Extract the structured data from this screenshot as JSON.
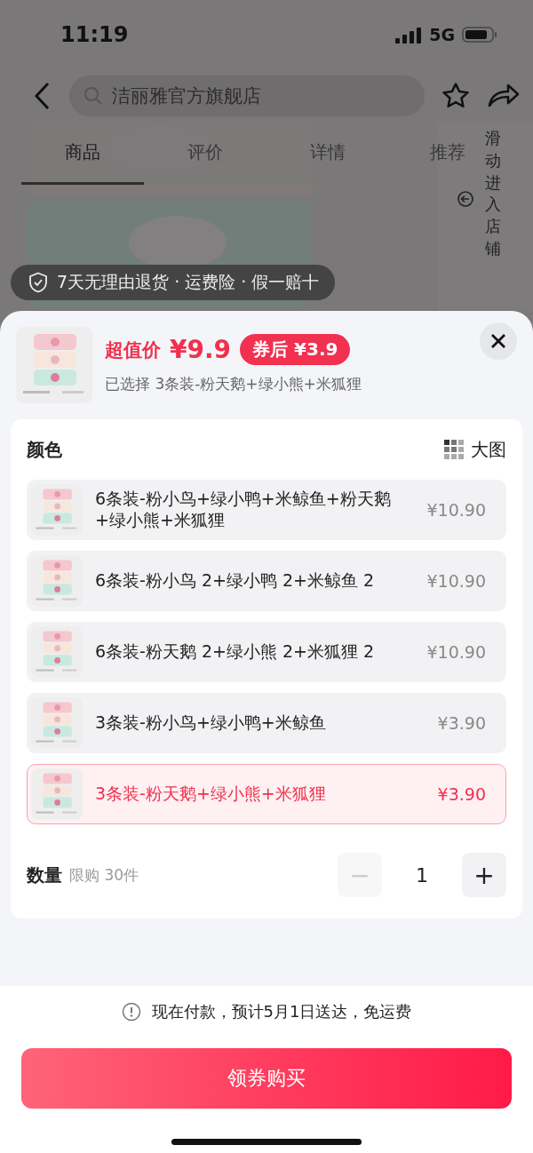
{
  "status_bar": {
    "time": "11:19",
    "network": "5G"
  },
  "nav": {
    "search": {
      "placeholder": "洁丽雅官方旗舰店"
    }
  },
  "tabs": [
    {
      "label": "商品",
      "selected": true
    },
    {
      "label": "评价",
      "selected": false
    },
    {
      "label": "详情",
      "selected": false
    },
    {
      "label": "推荐",
      "selected": false
    }
  ],
  "side_panel": {
    "label": "滑动进入店铺"
  },
  "guarantee": {
    "text": "7天无理由退货 · 运费险 · 假一赔十"
  },
  "sheet": {
    "price_label": "超值价",
    "price": "¥9.9",
    "coupon": "券后 ¥3.9",
    "selected_text": "已选择 3条装-粉天鹅+绿小熊+米狐狸",
    "color_section": {
      "title": "颜色",
      "view_toggle": "大图",
      "options": [
        {
          "name": "6条装-粉小鸟+绿小鸭+米鲸鱼+粉天鹅+绿小熊+米狐狸",
          "price": "¥10.90",
          "selected": false
        },
        {
          "name": "6条装-粉小鸟 2+绿小鸭 2+米鲸鱼 2",
          "price": "¥10.90",
          "selected": false
        },
        {
          "name": "6条装-粉天鹅 2+绿小熊 2+米狐狸 2",
          "price": "¥10.90",
          "selected": false
        },
        {
          "name": "3条装-粉小鸟+绿小鸭+米鲸鱼",
          "price": "¥3.90",
          "selected": false
        },
        {
          "name": "3条装-粉天鹅+绿小熊+米狐狸",
          "price": "¥3.90",
          "selected": true
        }
      ]
    },
    "quantity": {
      "label": "数量",
      "limit": "限购 30件",
      "value": "1",
      "minus": "−",
      "plus": "+",
      "minus_disabled": true
    }
  },
  "footer": {
    "notice": "现在付款，预计5月1日送达，免运费",
    "buy_button": "领券购买"
  }
}
